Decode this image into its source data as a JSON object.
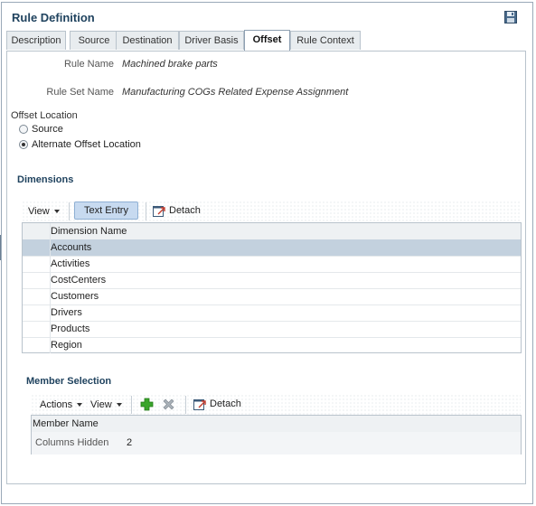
{
  "panel": {
    "title": "Rule Definition"
  },
  "tabs": [
    {
      "label": "Description",
      "active": false
    },
    {
      "label": "Source",
      "active": false
    },
    {
      "label": "Destination",
      "active": false
    },
    {
      "label": "Driver Basis",
      "active": false
    },
    {
      "label": "Offset",
      "active": true
    },
    {
      "label": "Rule Context",
      "active": false
    }
  ],
  "rule": {
    "name_label": "Rule Name",
    "name_value": "Machined brake parts",
    "set_label": "Rule Set Name",
    "set_value": "Manufacturing COGs Related Expense Assignment"
  },
  "offset_location": {
    "label": "Offset Location",
    "options": [
      {
        "label": "Source",
        "checked": false
      },
      {
        "label": "Alternate Offset Location",
        "checked": true
      }
    ]
  },
  "dimensions": {
    "heading": "Dimensions",
    "toolbar": {
      "view_label": "View",
      "text_entry_label": "Text Entry",
      "detach_label": "Detach"
    },
    "column_header": "Dimension Name",
    "rows": [
      "Accounts",
      "Activities",
      "CostCenters",
      "Customers",
      "Drivers",
      "Products",
      "Region"
    ],
    "selected_index": 0
  },
  "member_selection": {
    "heading": "Member Selection",
    "toolbar": {
      "actions_label": "Actions",
      "view_label": "View",
      "detach_label": "Detach"
    },
    "column_header": "Member Name",
    "columns_hidden_label": "Columns Hidden",
    "columns_hidden_value": "2"
  },
  "icons": {
    "save": "save-icon",
    "add": "plus-icon",
    "delete": "x-icon",
    "detach": "detach-icon"
  },
  "colors": {
    "heading": "#20435f",
    "selected_row": "#c3d1de",
    "add_icon": "#3aa52b",
    "text_entry_bg": "#c7daf0"
  }
}
